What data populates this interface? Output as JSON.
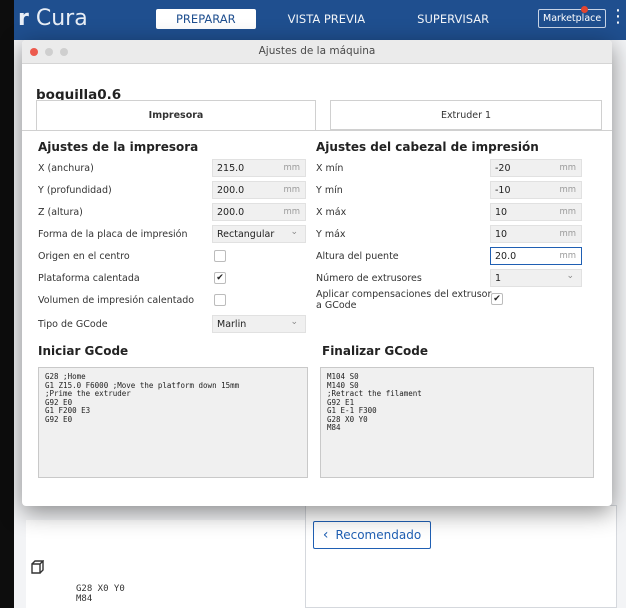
{
  "app": {
    "logo_main": "r",
    "logo_rest": " Cura",
    "stages": [
      "PREPARAR",
      "VISTA PREVIA",
      "SUPERVISAR"
    ],
    "marketplace_label": "Marketplace",
    "menu_icon": "vertical-ellipsis-icon"
  },
  "background": {
    "recommended_label": "Recomendado",
    "gcode_lines": [
      "G28 X0 Y0",
      "M84"
    ]
  },
  "dialog": {
    "title": "Ajustes de la máquina",
    "machine_name": "boquilla0.6",
    "tabs": [
      "Impresora",
      "Extruder 1"
    ],
    "printer": {
      "heading": "Ajustes de la impresora",
      "width": {
        "label": "X (anchura)",
        "value": "215.0",
        "unit": "mm"
      },
      "depth": {
        "label": "Y (profundidad)",
        "value": "200.0",
        "unit": "mm"
      },
      "height": {
        "label": "Z (altura)",
        "value": "200.0",
        "unit": "mm"
      },
      "plate_shape": {
        "label": "Forma de la placa de impresión",
        "value": "Rectangular"
      },
      "origin_center": {
        "label": "Origen en el centro",
        "checked": false
      },
      "heated_bed": {
        "label": "Plataforma calentada",
        "checked": true
      },
      "heated_volume": {
        "label": "Volumen de impresión calentado",
        "checked": false
      },
      "gcode_flavor": {
        "label": "Tipo de GCode",
        "value": "Marlin"
      }
    },
    "printhead": {
      "heading": "Ajustes del cabezal de impresión",
      "xmin": {
        "label": "X mín",
        "value": "-20",
        "unit": "mm"
      },
      "ymin": {
        "label": "Y mín",
        "value": "-10",
        "unit": "mm"
      },
      "xmax": {
        "label": "X máx",
        "value": "10",
        "unit": "mm"
      },
      "ymax": {
        "label": "Y máx",
        "value": "10",
        "unit": "mm"
      },
      "gantry": {
        "label": "Altura del puente",
        "value": "20.0",
        "unit": "mm"
      },
      "extruders": {
        "label": "Número de extrusores",
        "value": "1"
      },
      "apply_offsets": {
        "label_line1": "Aplicar compensaciones del extrusor",
        "label_line2": "a GCode",
        "checked": true
      }
    },
    "start_gcode": {
      "heading": "Iniciar GCode",
      "text": "G28 ;Home\nG1 Z15.0 F6000 ;Move the platform down 15mm\n;Prime the extruder\nG92 E0\nG1 F200 E3\nG92 E0"
    },
    "end_gcode": {
      "heading": "Finalizar GCode",
      "text": "M104 S0\nM140 S0\n;Retract the filament\nG92 E1\nG1 E-1 F300\nG28 X0 Y0\nM84"
    }
  }
}
